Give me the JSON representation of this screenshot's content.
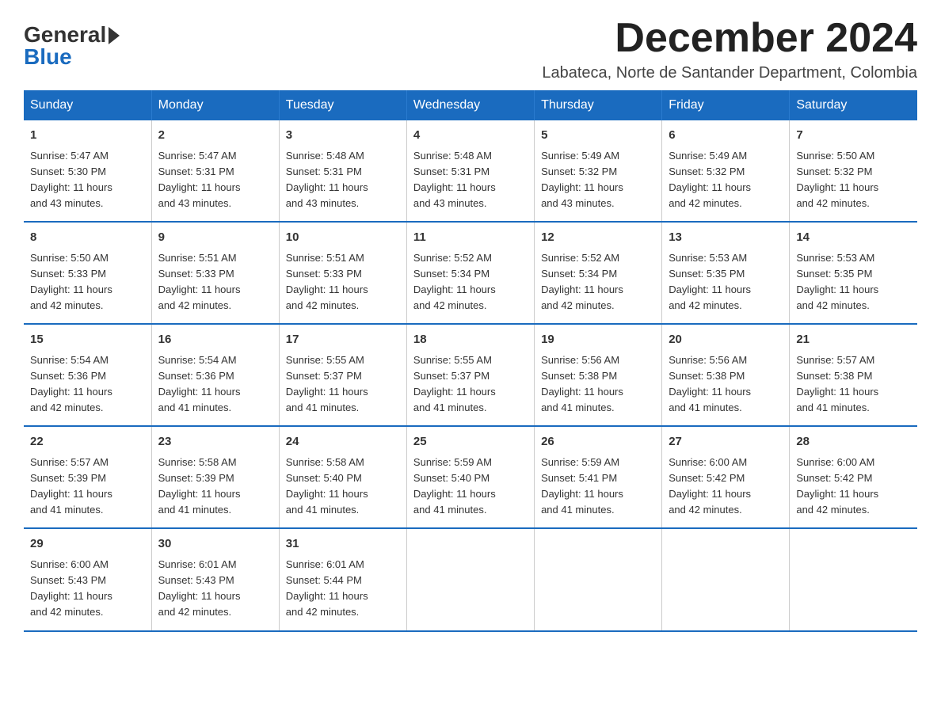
{
  "logo": {
    "general": "General",
    "blue": "Blue"
  },
  "header": {
    "month_title": "December 2024",
    "location": "Labateca, Norte de Santander Department, Colombia"
  },
  "days_of_week": [
    "Sunday",
    "Monday",
    "Tuesday",
    "Wednesday",
    "Thursday",
    "Friday",
    "Saturday"
  ],
  "weeks": [
    [
      {
        "day": "1",
        "sunrise": "5:47 AM",
        "sunset": "5:30 PM",
        "daylight": "11 hours and 43 minutes."
      },
      {
        "day": "2",
        "sunrise": "5:47 AM",
        "sunset": "5:31 PM",
        "daylight": "11 hours and 43 minutes."
      },
      {
        "day": "3",
        "sunrise": "5:48 AM",
        "sunset": "5:31 PM",
        "daylight": "11 hours and 43 minutes."
      },
      {
        "day": "4",
        "sunrise": "5:48 AM",
        "sunset": "5:31 PM",
        "daylight": "11 hours and 43 minutes."
      },
      {
        "day": "5",
        "sunrise": "5:49 AM",
        "sunset": "5:32 PM",
        "daylight": "11 hours and 43 minutes."
      },
      {
        "day": "6",
        "sunrise": "5:49 AM",
        "sunset": "5:32 PM",
        "daylight": "11 hours and 42 minutes."
      },
      {
        "day": "7",
        "sunrise": "5:50 AM",
        "sunset": "5:32 PM",
        "daylight": "11 hours and 42 minutes."
      }
    ],
    [
      {
        "day": "8",
        "sunrise": "5:50 AM",
        "sunset": "5:33 PM",
        "daylight": "11 hours and 42 minutes."
      },
      {
        "day": "9",
        "sunrise": "5:51 AM",
        "sunset": "5:33 PM",
        "daylight": "11 hours and 42 minutes."
      },
      {
        "day": "10",
        "sunrise": "5:51 AM",
        "sunset": "5:33 PM",
        "daylight": "11 hours and 42 minutes."
      },
      {
        "day": "11",
        "sunrise": "5:52 AM",
        "sunset": "5:34 PM",
        "daylight": "11 hours and 42 minutes."
      },
      {
        "day": "12",
        "sunrise": "5:52 AM",
        "sunset": "5:34 PM",
        "daylight": "11 hours and 42 minutes."
      },
      {
        "day": "13",
        "sunrise": "5:53 AM",
        "sunset": "5:35 PM",
        "daylight": "11 hours and 42 minutes."
      },
      {
        "day": "14",
        "sunrise": "5:53 AM",
        "sunset": "5:35 PM",
        "daylight": "11 hours and 42 minutes."
      }
    ],
    [
      {
        "day": "15",
        "sunrise": "5:54 AM",
        "sunset": "5:36 PM",
        "daylight": "11 hours and 42 minutes."
      },
      {
        "day": "16",
        "sunrise": "5:54 AM",
        "sunset": "5:36 PM",
        "daylight": "11 hours and 41 minutes."
      },
      {
        "day": "17",
        "sunrise": "5:55 AM",
        "sunset": "5:37 PM",
        "daylight": "11 hours and 41 minutes."
      },
      {
        "day": "18",
        "sunrise": "5:55 AM",
        "sunset": "5:37 PM",
        "daylight": "11 hours and 41 minutes."
      },
      {
        "day": "19",
        "sunrise": "5:56 AM",
        "sunset": "5:38 PM",
        "daylight": "11 hours and 41 minutes."
      },
      {
        "day": "20",
        "sunrise": "5:56 AM",
        "sunset": "5:38 PM",
        "daylight": "11 hours and 41 minutes."
      },
      {
        "day": "21",
        "sunrise": "5:57 AM",
        "sunset": "5:38 PM",
        "daylight": "11 hours and 41 minutes."
      }
    ],
    [
      {
        "day": "22",
        "sunrise": "5:57 AM",
        "sunset": "5:39 PM",
        "daylight": "11 hours and 41 minutes."
      },
      {
        "day": "23",
        "sunrise": "5:58 AM",
        "sunset": "5:39 PM",
        "daylight": "11 hours and 41 minutes."
      },
      {
        "day": "24",
        "sunrise": "5:58 AM",
        "sunset": "5:40 PM",
        "daylight": "11 hours and 41 minutes."
      },
      {
        "day": "25",
        "sunrise": "5:59 AM",
        "sunset": "5:40 PM",
        "daylight": "11 hours and 41 minutes."
      },
      {
        "day": "26",
        "sunrise": "5:59 AM",
        "sunset": "5:41 PM",
        "daylight": "11 hours and 41 minutes."
      },
      {
        "day": "27",
        "sunrise": "6:00 AM",
        "sunset": "5:42 PM",
        "daylight": "11 hours and 42 minutes."
      },
      {
        "day": "28",
        "sunrise": "6:00 AM",
        "sunset": "5:42 PM",
        "daylight": "11 hours and 42 minutes."
      }
    ],
    [
      {
        "day": "29",
        "sunrise": "6:00 AM",
        "sunset": "5:43 PM",
        "daylight": "11 hours and 42 minutes."
      },
      {
        "day": "30",
        "sunrise": "6:01 AM",
        "sunset": "5:43 PM",
        "daylight": "11 hours and 42 minutes."
      },
      {
        "day": "31",
        "sunrise": "6:01 AM",
        "sunset": "5:44 PM",
        "daylight": "11 hours and 42 minutes."
      },
      null,
      null,
      null,
      null
    ]
  ],
  "labels": {
    "sunrise_prefix": "Sunrise: ",
    "sunset_prefix": "Sunset: ",
    "daylight_prefix": "Daylight: "
  }
}
